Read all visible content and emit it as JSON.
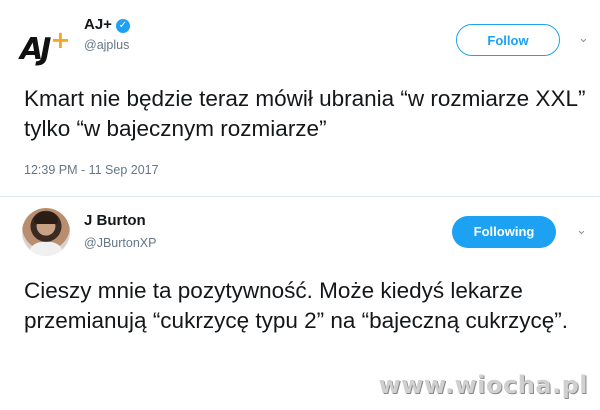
{
  "tweet1": {
    "display_name": "AJ+",
    "handle": "@ajplus",
    "logo_text": "AJ",
    "logo_plus": "+",
    "verified_glyph": "✓",
    "follow_label": "Follow",
    "text": "Kmart nie będzie teraz mówił ubrania “w rozmiarze XXL” tylko “w bajecznym rozmiarze”",
    "timestamp": "12:39 PM - 11 Sep 2017"
  },
  "tweet2": {
    "display_name": "J Burton",
    "handle": "@JBurtonXP",
    "follow_label": "Following",
    "text": "Cieszy mnie ta pozytywność. Może kiedyś lekarze przemianują “cukrzycę typu 2” na “bajeczną cukrzycę”."
  },
  "icons": {
    "menu_chevron": "⌄"
  },
  "watermark": "www.wiocha.pl",
  "colors": {
    "accent": "#1da1f2",
    "text": "#14171a",
    "muted": "#657786"
  }
}
